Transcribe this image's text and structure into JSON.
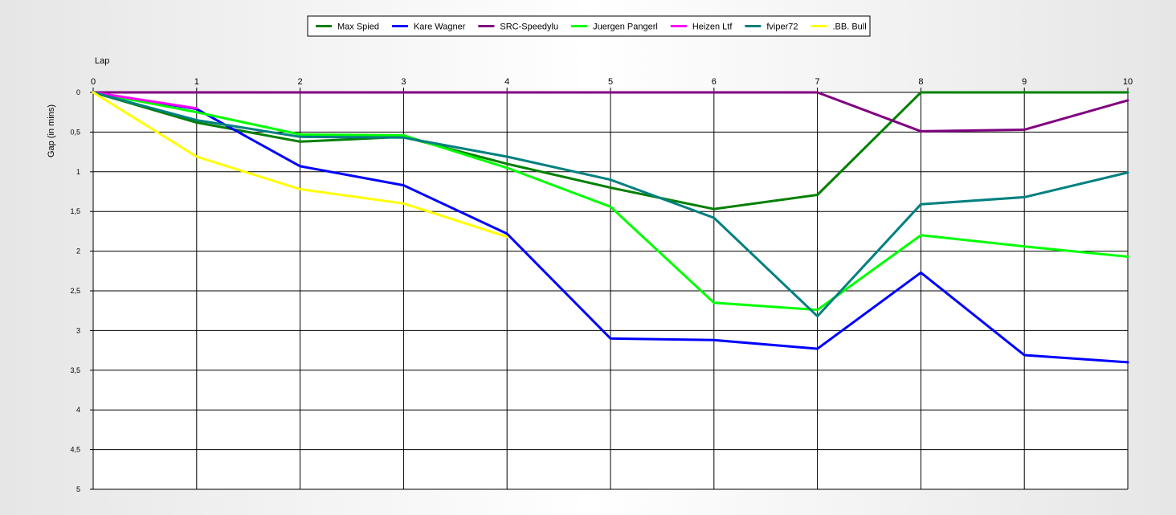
{
  "chart_data": {
    "type": "line",
    "xlabel": "Lap",
    "ylabel": "Gap (in mins)",
    "x_ticks": [
      "0",
      "1",
      "2",
      "3",
      "4",
      "5",
      "6",
      "7",
      "8",
      "9",
      "10"
    ],
    "y_ticks": [
      "0",
      "0,5",
      "1",
      "1,5",
      "2",
      "2,5",
      "3",
      "3,5",
      "4",
      "4,5",
      "5"
    ],
    "xlim": [
      0,
      10
    ],
    "ylim": [
      0,
      5
    ],
    "y_inverted": true,
    "x_axis_position": "top",
    "grid": true,
    "legend_position": "top-center",
    "series": [
      {
        "name": "Max Spied",
        "color": "#008000",
        "x": [
          0,
          1,
          2,
          3,
          4,
          5,
          6,
          7,
          8,
          9,
          10
        ],
        "values": [
          0,
          0.38,
          0.62,
          0.56,
          0.9,
          1.2,
          1.47,
          1.29,
          0,
          0,
          0
        ]
      },
      {
        "name": "Kare Wagner",
        "color": "#0000ff",
        "x": [
          0,
          1,
          2,
          3,
          4,
          5,
          6,
          7,
          8,
          9,
          10
        ],
        "values": [
          0,
          0.21,
          0.93,
          1.17,
          1.78,
          3.1,
          3.12,
          3.23,
          2.27,
          3.31,
          3.4
        ]
      },
      {
        "name": "SRC-Speedylu",
        "color": "#800080",
        "x": [
          0,
          1,
          2,
          3,
          4,
          5,
          6,
          7,
          8,
          9,
          10
        ],
        "values": [
          0,
          0,
          0,
          0,
          0,
          0,
          0,
          0,
          0.49,
          0.47,
          0.1
        ]
      },
      {
        "name": "Juergen Pangerl",
        "color": "#00ff00",
        "x": [
          0,
          1,
          2,
          3,
          4,
          5,
          6,
          7,
          8,
          9,
          10
        ],
        "values": [
          0,
          0.25,
          0.53,
          0.54,
          0.95,
          1.44,
          2.65,
          2.74,
          1.8,
          1.94,
          2.07
        ]
      },
      {
        "name": "Heizen Ltf",
        "color": "#ff00ff",
        "x": [
          0,
          1
        ],
        "values": [
          0,
          0.2
        ]
      },
      {
        "name": "fviper72",
        "color": "#008080",
        "x": [
          0,
          1,
          2,
          3,
          4,
          5,
          6,
          7,
          8,
          9,
          10
        ],
        "values": [
          0,
          0.35,
          0.56,
          0.57,
          0.81,
          1.1,
          1.58,
          2.82,
          1.41,
          1.32,
          1.01
        ]
      },
      {
        "name": ".BB. Bull",
        "color": "#ffff00",
        "x": [
          0,
          1,
          2,
          3,
          4
        ],
        "values": [
          0,
          0.81,
          1.22,
          1.4,
          1.82
        ]
      }
    ]
  }
}
